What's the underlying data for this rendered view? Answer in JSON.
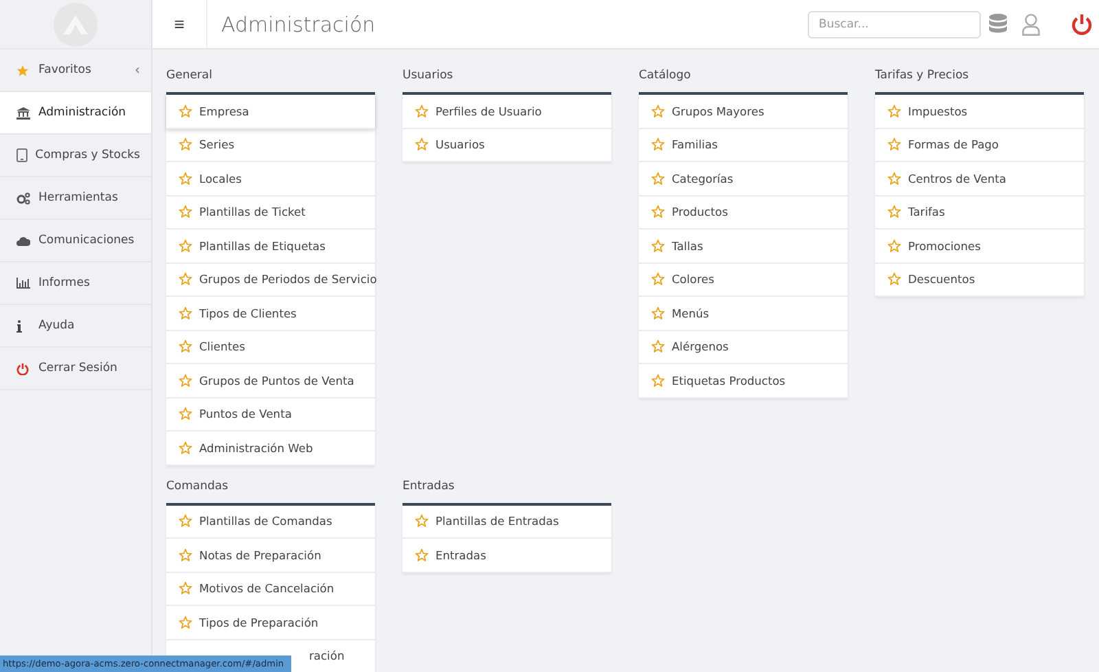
{
  "header": {
    "menu_glyph": "≡",
    "title": "Administración",
    "search": {
      "placeholder": "Buscar..."
    }
  },
  "sidebar": {
    "items": [
      {
        "label": "Favoritos",
        "selected": false,
        "chevron": "‹"
      },
      {
        "label": "Administración",
        "selected": true
      },
      {
        "label": "Compras y Stocks",
        "selected": false
      },
      {
        "label": "Herramientas",
        "selected": false
      },
      {
        "label": "Comunicaciones",
        "selected": false
      },
      {
        "label": "Informes",
        "selected": false
      },
      {
        "label": "Ayuda",
        "selected": false
      },
      {
        "label": "Cerrar Sesión",
        "selected": false
      }
    ]
  },
  "sections": [
    {
      "title": "General",
      "items": [
        {
          "label": "Empresa",
          "selected": true
        },
        {
          "label": "Series",
          "selected": false
        },
        {
          "label": "Locales",
          "selected": false
        },
        {
          "label": "Plantillas de Ticket",
          "selected": false
        },
        {
          "label": "Plantillas de Etiquetas",
          "selected": false
        },
        {
          "label": "Grupos de Periodos de Servicio",
          "selected": false
        },
        {
          "label": "Tipos de Clientes",
          "selected": false
        },
        {
          "label": "Clientes",
          "selected": false
        },
        {
          "label": "Grupos de Puntos de Venta",
          "selected": false
        },
        {
          "label": "Puntos de Venta",
          "selected": false
        },
        {
          "label": "Administración Web",
          "selected": false
        }
      ]
    },
    {
      "title": "Usuarios",
      "items": [
        {
          "label": "Perfiles de Usuario",
          "selected": false
        },
        {
          "label": "Usuarios",
          "selected": false
        }
      ]
    },
    {
      "title": "Catálogo",
      "items": [
        {
          "label": "Grupos Mayores",
          "selected": false
        },
        {
          "label": "Familias",
          "selected": false
        },
        {
          "label": "Categorías",
          "selected": false
        },
        {
          "label": "Productos",
          "selected": false
        },
        {
          "label": "Tallas",
          "selected": false
        },
        {
          "label": "Colores",
          "selected": false
        },
        {
          "label": "Menús",
          "selected": false
        },
        {
          "label": "Alérgenos",
          "selected": false
        },
        {
          "label": "Etiquetas Productos",
          "selected": false
        }
      ]
    },
    {
      "title": "Tarifas y Precios",
      "items": [
        {
          "label": "Impuestos",
          "selected": false
        },
        {
          "label": "Formas de Pago",
          "selected": false
        },
        {
          "label": "Centros de Venta",
          "selected": false
        },
        {
          "label": "Tarifas",
          "selected": false
        },
        {
          "label": "Promociones",
          "selected": false
        },
        {
          "label": "Descuentos",
          "selected": false
        }
      ]
    },
    {
      "title": "Comandas",
      "items": [
        {
          "label": "Plantillas de Comandas",
          "selected": false
        },
        {
          "label": "Notas de Preparación",
          "selected": false
        },
        {
          "label": "Motivos de Cancelación",
          "selected": false
        },
        {
          "label": "Tipos de Preparación",
          "selected": false
        },
        {
          "label": "ración",
          "selected": false,
          "kind": "covered"
        }
      ]
    },
    {
      "title": "Entradas",
      "items": [
        {
          "label": "Plantillas de Entradas",
          "selected": false
        },
        {
          "label": "Entradas",
          "selected": false
        }
      ]
    }
  ],
  "status_bar": {
    "url": "https://demo-agora-acms.zero-connectmanager.com/#/admin"
  }
}
